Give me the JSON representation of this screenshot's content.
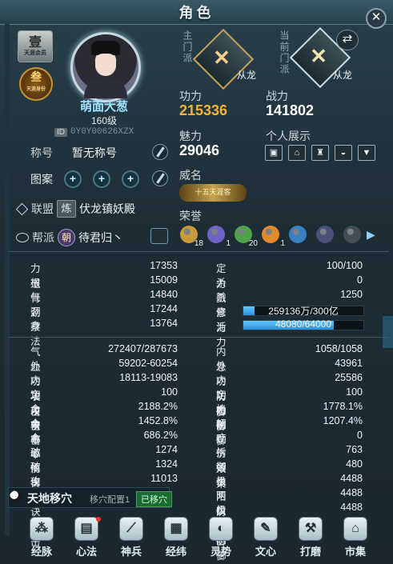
{
  "window": {
    "title": "角色",
    "close_glyph": "✕"
  },
  "profile": {
    "medal1": {
      "char": "壹",
      "sub": "天涯会员"
    },
    "medal2": {
      "char": "叁",
      "sub": "天涯身份"
    },
    "name": "萌面大葱",
    "level": "160级",
    "id_tag": "ID",
    "id_value": "0Y0Y00626XZX",
    "title_label": "称号",
    "title_value": "暂无称号",
    "pattern_label": "图案",
    "alliance_label": "联盟",
    "alliance_badge": "炼",
    "alliance_value": "伏龙镇妖殿",
    "guild_label": "帮派",
    "guild_badge": "朝",
    "guild_value": "待君归丶"
  },
  "school": {
    "main_label": "主门派",
    "main_name": "从龙",
    "current_label": "当前门派",
    "current_name": "从龙",
    "swap_glyph": "⇄"
  },
  "stats_top": {
    "gongli_label": "功力",
    "gongli_value": "215336",
    "zhanli_label": "战力",
    "zhanli_value": "141802",
    "meili_label": "魅力",
    "meili_value": "29046",
    "showcase_label": "个人展示",
    "showcase_icons": [
      "id-card-icon",
      "house-icon",
      "castle-icon",
      "boat-icon",
      "armor-icon"
    ],
    "weiming_label": "威名",
    "weiming_badge": "十五天涯客",
    "rongyu_label": "荣誉",
    "honors": [
      {
        "icon": "sword-honor-icon",
        "count": "18",
        "color": "#c99a3a"
      },
      {
        "icon": "ring-honor-icon",
        "count": "1",
        "color": "#6e64c6"
      },
      {
        "icon": "cert-honor-icon",
        "count": "20",
        "color": "#4fa14a"
      },
      {
        "icon": "master-honor-icon",
        "count": "1",
        "color": "#e08a2a"
      },
      {
        "icon": "rank-honor-icon",
        "count": "",
        "color": "#3a7fc2"
      },
      {
        "icon": "moon-honor-icon",
        "count": "",
        "color": "#4d4d7a"
      },
      {
        "icon": "mask-honor-icon",
        "count": "",
        "color": "#444b52"
      }
    ],
    "honor_arrow": "▶"
  },
  "attr_left_1": [
    {
      "k": "力道",
      "v": "17353"
    },
    {
      "k": "根骨",
      "v": "15009"
    },
    {
      "k": "气劲",
      "v": "14840"
    },
    {
      "k": "洞察",
      "v": "17244"
    },
    {
      "k": "身法",
      "v": "13764"
    }
  ],
  "attr_right_1": [
    {
      "k": "定力",
      "v": "100/100"
    },
    {
      "k": "杀戮",
      "v": "0"
    },
    {
      "k": "杀意",
      "v": "1250"
    }
  ],
  "bars": {
    "xiuwei_label": "修为",
    "xiuwei_text": "259136万/300亿",
    "xiuwei_frac": 0.09,
    "huoli_label": "活力",
    "huoli_text": "48080/64000",
    "huoli_frac": 0.751
  },
  "attr_left_2": [
    {
      "k": "气血",
      "v": "272407/287673"
    },
    {
      "k": "外功攻击",
      "v": "59202-60254"
    },
    {
      "k": "内功攻击",
      "v": "18113-19083"
    },
    {
      "k": "定力攻击",
      "v": "100"
    },
    {
      "k": "命中率",
      "v": "2188.2%"
    },
    {
      "k": "会心率",
      "v": "1452.8%"
    },
    {
      "k": "会心伤害",
      "v": "686.2%"
    },
    {
      "k": "破招",
      "v": "1274"
    },
    {
      "k": "破伤",
      "v": "1324"
    },
    {
      "k": "攻心诀攻击",
      "v": "11013"
    }
  ],
  "attr_right_2": [
    {
      "k": "内息",
      "v": "1058/1058"
    },
    {
      "k": "外功防御",
      "v": "43961"
    },
    {
      "k": "内功防御",
      "v": "25586"
    },
    {
      "k": "定力防御",
      "v": "100"
    },
    {
      "k": "格挡",
      "v": "1778.1%"
    },
    {
      "k": "韧劲",
      "v": "1207.4%"
    },
    {
      "k": "疗伤效果",
      "v": "0"
    },
    {
      "k": "拆招",
      "v": "763"
    },
    {
      "k": "御伤",
      "v": "480"
    },
    {
      "k": "极阳防御",
      "v": "4488"
    },
    {
      "k": "两仪防御",
      "v": "4488"
    },
    {
      "k": "极阴防御",
      "v": "4488"
    }
  ],
  "move": {
    "title": "天地移穴",
    "config": "移穴配置1",
    "tag": "已移穴"
  },
  "bottom_buttons": [
    {
      "label": "经脉",
      "icon": "meridian-icon",
      "glyph": "⁂"
    },
    {
      "label": "心法",
      "icon": "book-icon",
      "glyph": "▤",
      "dot": true
    },
    {
      "label": "神兵",
      "icon": "weapon-icon",
      "glyph": "⟋"
    },
    {
      "label": "经纬",
      "icon": "grid-icon",
      "glyph": "▦"
    },
    {
      "label": "灵势",
      "icon": "spirit-icon",
      "glyph": "◐"
    },
    {
      "label": "文心",
      "icon": "brush-icon",
      "glyph": "✎"
    },
    {
      "label": "打磨",
      "icon": "hammer-icon",
      "glyph": "⚒"
    },
    {
      "label": "市集",
      "icon": "market-icon",
      "glyph": "⌂"
    }
  ],
  "colors": {
    "gongli": "#f3b33a",
    "zhanli": "#ffffff",
    "name": "#9de3ff"
  }
}
